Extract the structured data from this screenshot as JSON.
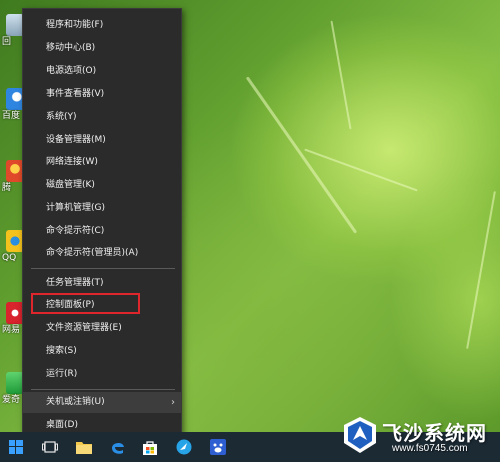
{
  "desktop": {
    "icons": [
      {
        "label": "回",
        "icon": "recycle-bin-icon",
        "color": "#9fb7c9"
      },
      {
        "label": "百度",
        "icon": "baidu-netdisk-icon",
        "color": "#2f86e0"
      },
      {
        "label": "腾",
        "icon": "tencent-icon",
        "color": "#e04a2a"
      },
      {
        "label": "QQ",
        "icon": "qq-browser-icon",
        "color": "#f4c21d"
      },
      {
        "label": "网易",
        "icon": "netease-music-icon",
        "color": "#d9232d"
      },
      {
        "label": "爱奇",
        "icon": "iqiyi-icon",
        "color": "#2fb84a"
      }
    ]
  },
  "menu": {
    "group1": [
      {
        "label": "程序和功能(F)"
      },
      {
        "label": "移动中心(B)"
      },
      {
        "label": "电源选项(O)"
      },
      {
        "label": "事件查看器(V)"
      },
      {
        "label": "系统(Y)"
      },
      {
        "label": "设备管理器(M)"
      },
      {
        "label": "网络连接(W)"
      },
      {
        "label": "磁盘管理(K)"
      },
      {
        "label": "计算机管理(G)"
      },
      {
        "label": "命令提示符(C)"
      },
      {
        "label": "命令提示符(管理员)(A)"
      }
    ],
    "group2": [
      {
        "label": "任务管理器(T)"
      },
      {
        "label": "控制面板(P)"
      },
      {
        "label": "文件资源管理器(E)"
      },
      {
        "label": "搜索(S)"
      },
      {
        "label": "运行(R)"
      }
    ],
    "group3": [
      {
        "label": "关机或注销(U)",
        "submenu_arrow": "›"
      },
      {
        "label": "桌面(D)"
      }
    ],
    "highlight_color": "#e0262d"
  },
  "taskbar": {
    "buttons": [
      "start-icon",
      "task-view-icon",
      "file-explorer-icon",
      "edge-icon",
      "store-icon",
      "qq-browser-taskbar-icon",
      "baidu-taskbar-icon"
    ]
  },
  "watermark": {
    "title": "飞沙系统网",
    "url": "www.fs0745.com"
  }
}
